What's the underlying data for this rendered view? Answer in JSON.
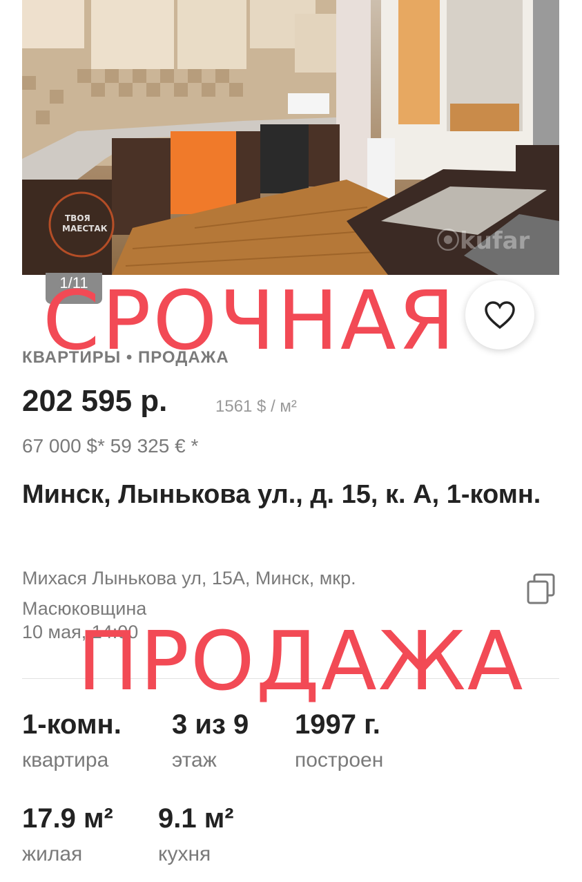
{
  "gallery": {
    "counter": "1/11",
    "watermark_logo": "ТВОЯ МАЕСТАК",
    "watermark_site": "kufar"
  },
  "overlay": {
    "line1": "СРОЧНАЯ",
    "line2": "ПРОДАЖА",
    "color": "#f24a55"
  },
  "listing": {
    "category": "КВАРТИРЫ • ПРОДАЖА",
    "price": "202 595 р.",
    "price_per_m2": "1561 $ / м²",
    "currency_alt": "67 000 $*  59 325 € *",
    "title": "Минск, Лынькова ул., д. 15, к. А, 1-комн.",
    "address": "Михася Лынькова ул, 15А, Минск, мкр. Масюковщина",
    "date": "10 мая, 14:00"
  },
  "specs": [
    {
      "value": "1-комн.",
      "label": "квартира"
    },
    {
      "value": "3 из 9",
      "label": "этаж"
    },
    {
      "value": "1997 г.",
      "label": "построен"
    },
    {
      "value": "17.9 м²",
      "label": "жилая"
    },
    {
      "value": "9.1 м²",
      "label": "кухня"
    }
  ],
  "icons": {
    "favorite": "heart-icon",
    "copy": "copy-icon"
  }
}
